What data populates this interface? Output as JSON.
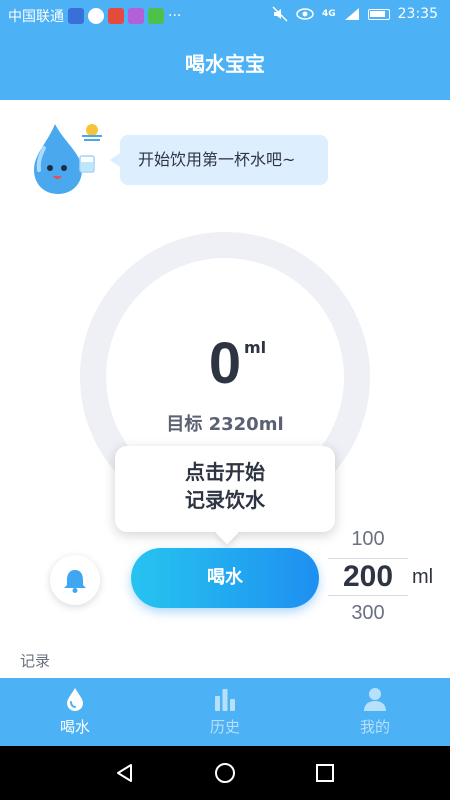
{
  "status_bar": {
    "carrier": "中国联通",
    "more": "···",
    "network": "4G",
    "time": "23:35"
  },
  "header": {
    "title": "喝水宝宝"
  },
  "mascot": {
    "speech": "开始饮用第一杯水吧~"
  },
  "progress": {
    "amount": "0",
    "unit": "ml",
    "goal_label": "目标 2320ml",
    "fraction": 0
  },
  "tooltip": {
    "line1": "点击开始",
    "line2": "记录饮水"
  },
  "actions": {
    "drink_label": "喝水",
    "picker": {
      "above": "100",
      "selected": "200",
      "below": "300",
      "unit": "ml"
    }
  },
  "records_label": "记录",
  "tabs": [
    {
      "label": "喝水",
      "icon": "water-drop-icon",
      "active": true
    },
    {
      "label": "历史",
      "icon": "bar-chart-icon",
      "active": false
    },
    {
      "label": "我的",
      "icon": "user-icon",
      "active": false
    }
  ],
  "colors": {
    "primary": "#4cb1f5",
    "button_start": "#27c4f0",
    "button_end": "#1e8ff0",
    "ring": "#eef0f6"
  },
  "icons": {
    "bell": "bell-icon",
    "back": "back-triangle-icon",
    "home": "home-circle-icon",
    "recent": "recent-square-icon"
  }
}
